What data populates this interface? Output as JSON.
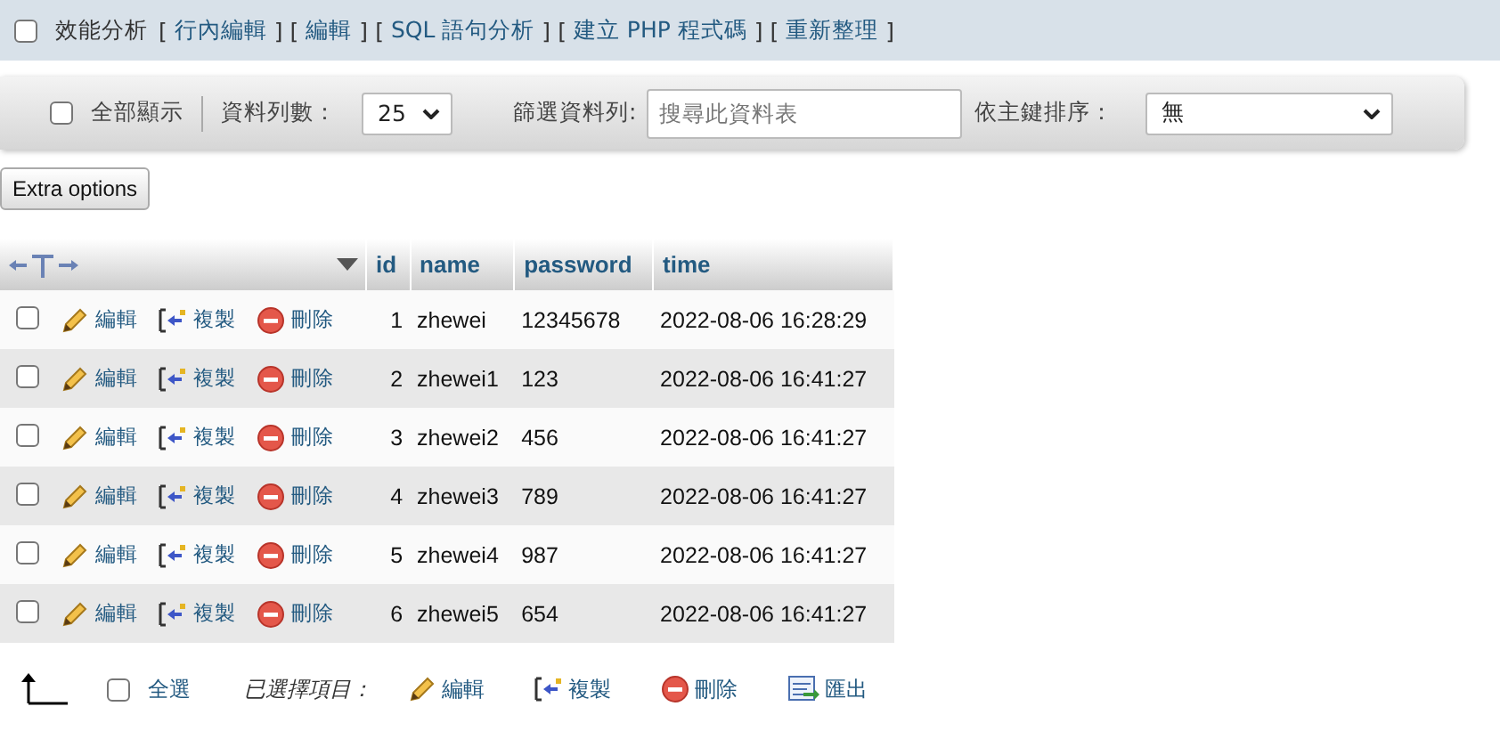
{
  "top_bar": {
    "checked": false,
    "label": "效能分析",
    "bracket_open": "[",
    "bracket_close": "]",
    "links": [
      "行內編輯",
      "編輯",
      "SQL 語句分析",
      "建立 PHP 程式碼",
      "重新整理"
    ]
  },
  "toolbar": {
    "show_all": {
      "checked": false,
      "label": "全部顯示"
    },
    "rows_label": "資料列數：",
    "rows_select": "25",
    "filter_label": "篩選資料列:",
    "filter_placeholder": "搜尋此資料表",
    "sort_label": "依主鍵排序：",
    "sort_select": "無"
  },
  "extra_options": "Extra options",
  "table": {
    "columns": [
      "id",
      "name",
      "password",
      "time"
    ],
    "rows": [
      {
        "checked": false,
        "actions": [
          {
            "kind": "edit",
            "label": "編輯"
          },
          {
            "kind": "copy",
            "label": "複製"
          },
          {
            "kind": "delete",
            "label": "刪除"
          }
        ],
        "cells": [
          "1",
          "zhewei",
          "12345678",
          "2022-08-06 16:28:29"
        ]
      },
      {
        "checked": false,
        "actions": [
          {
            "kind": "edit",
            "label": "編輯"
          },
          {
            "kind": "copy",
            "label": "複製"
          },
          {
            "kind": "delete",
            "label": "刪除"
          }
        ],
        "cells": [
          "2",
          "zhewei1",
          "123",
          "2022-08-06 16:41:27"
        ]
      },
      {
        "checked": false,
        "actions": [
          {
            "kind": "edit",
            "label": "編輯"
          },
          {
            "kind": "copy",
            "label": "複製"
          },
          {
            "kind": "delete",
            "label": "刪除"
          }
        ],
        "cells": [
          "3",
          "zhewei2",
          "456",
          "2022-08-06 16:41:27"
        ]
      },
      {
        "checked": false,
        "actions": [
          {
            "kind": "edit",
            "label": "編輯"
          },
          {
            "kind": "copy",
            "label": "複製"
          },
          {
            "kind": "delete",
            "label": "刪除"
          }
        ],
        "cells": [
          "4",
          "zhewei3",
          "789",
          "2022-08-06 16:41:27"
        ]
      },
      {
        "checked": false,
        "actions": [
          {
            "kind": "edit",
            "label": "編輯"
          },
          {
            "kind": "copy",
            "label": "複製"
          },
          {
            "kind": "delete",
            "label": "刪除"
          }
        ],
        "cells": [
          "5",
          "zhewei4",
          "987",
          "2022-08-06 16:41:27"
        ]
      },
      {
        "checked": false,
        "actions": [
          {
            "kind": "edit",
            "label": "編輯"
          },
          {
            "kind": "copy",
            "label": "複製"
          },
          {
            "kind": "delete",
            "label": "刪除"
          }
        ],
        "cells": [
          "6",
          "zhewei5",
          "654",
          "2022-08-06 16:41:27"
        ]
      }
    ]
  },
  "footer": {
    "select_all": {
      "checked": false,
      "label": "全選"
    },
    "with_selected": "已選擇項目：",
    "actions": [
      {
        "kind": "edit",
        "label": "編輯"
      },
      {
        "kind": "copy",
        "label": "複製"
      },
      {
        "kind": "delete",
        "label": "刪除"
      },
      {
        "kind": "export",
        "label": "匯出"
      }
    ]
  }
}
